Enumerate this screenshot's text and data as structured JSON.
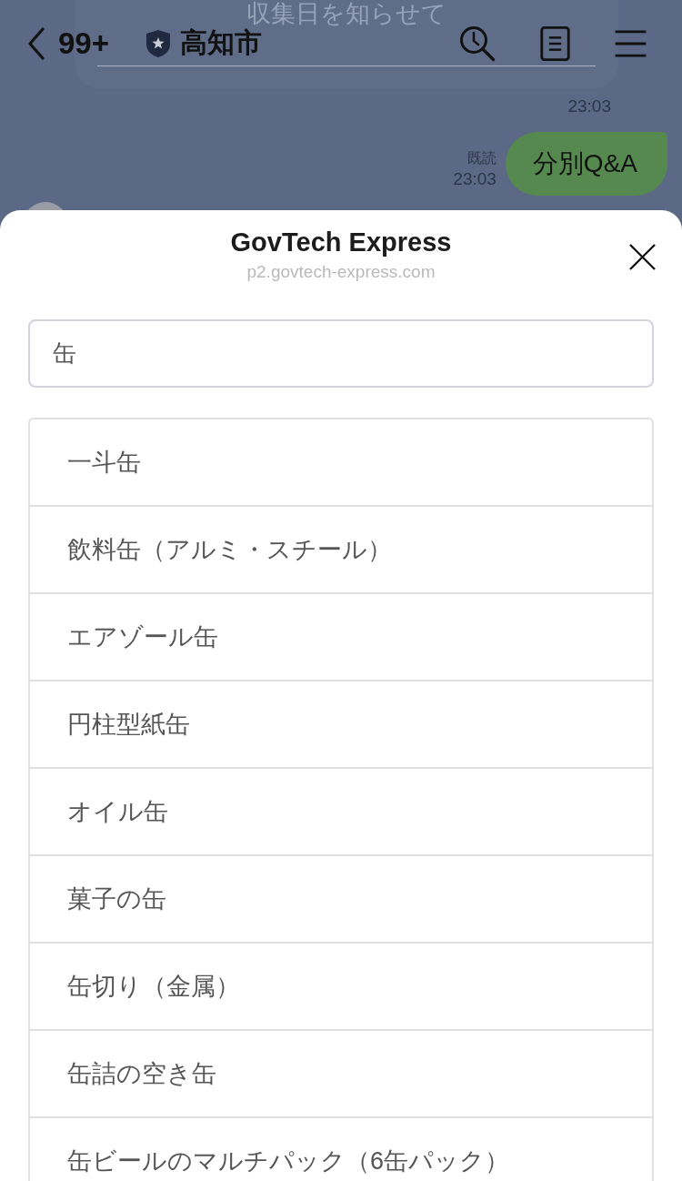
{
  "header": {
    "back_count": "99+",
    "title": "高知市"
  },
  "chat": {
    "card_button": "収集日を知らせて",
    "card_time": "23:03",
    "message": {
      "read_label": "既読",
      "time": "23:03",
      "text": "分別Q&A"
    }
  },
  "sheet": {
    "title": "GovTech Express",
    "url": "p2.govtech-express.com",
    "search": {
      "value": "缶"
    },
    "results": [
      "一斗缶",
      "飲料缶（アルミ・スチール）",
      "エアゾール缶",
      "円柱型紙缶",
      "オイル缶",
      "菓子の缶",
      "缶切り（金属）",
      "缶詰の空き缶",
      "缶ビールのマルチパック（6缶パック）"
    ]
  }
}
